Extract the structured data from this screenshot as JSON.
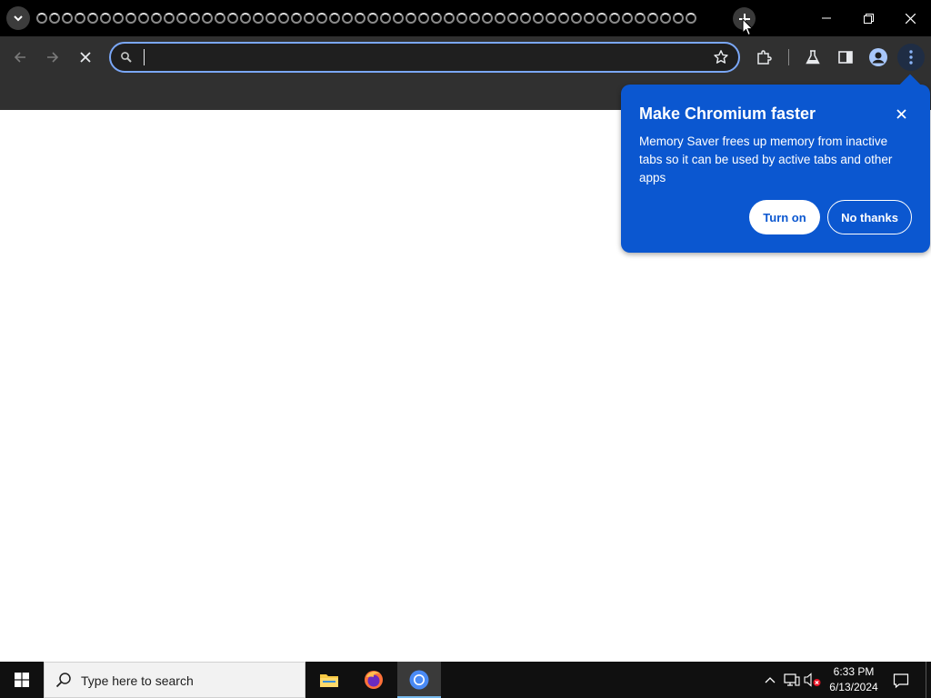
{
  "browser": {
    "tab_count_visible": 52,
    "tab_state": "loading",
    "omnibox": {
      "value": "",
      "placeholder": ""
    }
  },
  "icons": {
    "tab_search": "chevron-down-icon",
    "new_tab": "plus-icon",
    "minimize": "minimize-icon",
    "restore": "restore-icon",
    "close": "close-icon",
    "back": "arrow-left-icon",
    "forward": "arrow-right-icon",
    "stop": "stop-x-icon",
    "omni_search": "search-icon",
    "bookmark_star": "star-icon",
    "extensions": "puzzle-icon",
    "labs": "flask-icon",
    "side_panel": "side-panel-icon",
    "profile": "avatar-icon",
    "menu": "kebab-menu-icon"
  },
  "bubble": {
    "title": "Make Chromium faster",
    "body": "Memory Saver frees up memory from inactive tabs so it can be used by active tabs and other apps",
    "primary_button": "Turn on",
    "secondary_button": "No thanks"
  },
  "taskbar": {
    "search_placeholder": "Type here to search",
    "time": "6:33 PM",
    "date": "6/13/2024",
    "apps": [
      "file-explorer",
      "firefox",
      "chromium"
    ]
  },
  "colors": {
    "bubble_bg": "#0b57d0",
    "focus_ring": "#7aa7f7",
    "toolbar_bg": "#303030",
    "tabstrip_bg": "#000000"
  }
}
